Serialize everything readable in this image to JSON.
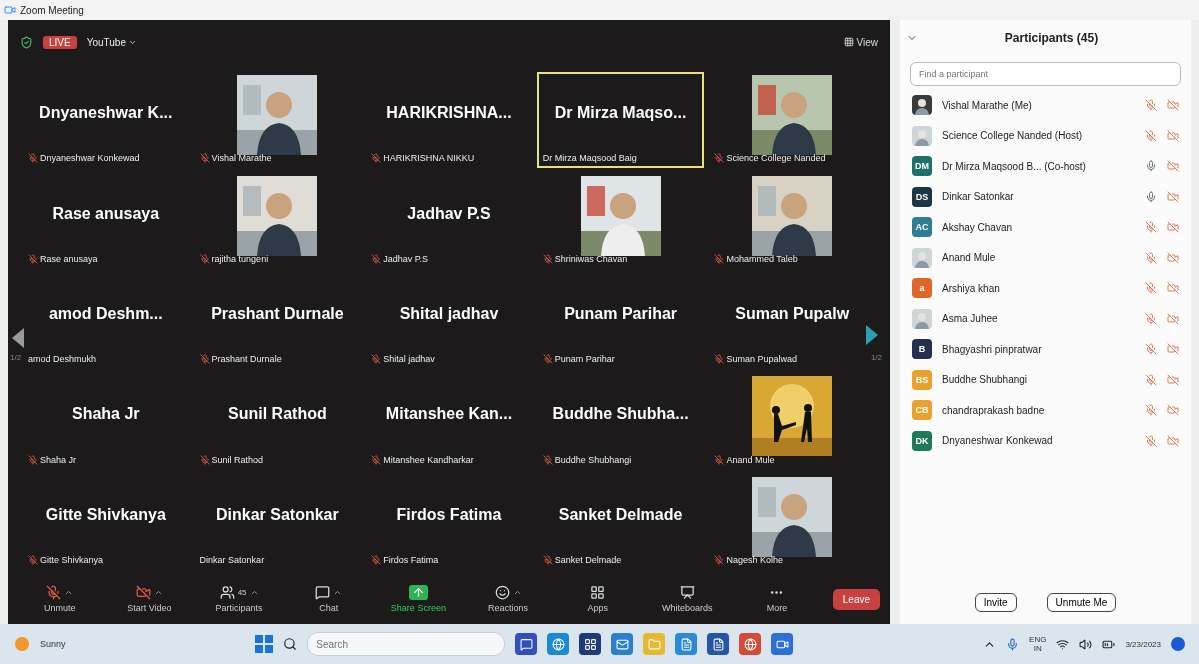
{
  "window": {
    "title": "Zoom Meeting"
  },
  "meeting_top": {
    "live": "LIVE",
    "stream": "YouTube",
    "view": "View"
  },
  "pager": {
    "left": "1/2",
    "right": "1/2"
  },
  "tiles": [
    {
      "kind": "name",
      "name": "Dnyaneshwar K...",
      "label": "Dnyaneshwar Konkewad",
      "muted": true,
      "highlighted": false
    },
    {
      "kind": "video",
      "label": "Vishal Marathe",
      "muted": true,
      "highlighted": false
    },
    {
      "kind": "name",
      "name": "HARIKRISHNA...",
      "label": "HARIKRISHNA NIKKU",
      "muted": true,
      "highlighted": false
    },
    {
      "kind": "name",
      "name": "Dr Mirza Maqso...",
      "label": "Dr Mirza Maqsood Baig",
      "muted": false,
      "highlighted": true
    },
    {
      "kind": "video",
      "label": "Science College Nanded",
      "muted": true,
      "highlighted": false
    },
    {
      "kind": "name",
      "name": "Rase anusaya",
      "label": "Rase anusaya",
      "muted": true,
      "highlighted": false
    },
    {
      "kind": "video",
      "label": "rajitha tungeni",
      "muted": true,
      "highlighted": false
    },
    {
      "kind": "name",
      "name": "Jadhav P.S",
      "label": "Jadhav P.S",
      "muted": true,
      "highlighted": false
    },
    {
      "kind": "video",
      "label": "Shriniwas Chavan",
      "muted": true,
      "highlighted": false
    },
    {
      "kind": "video",
      "label": "Mohammed Taleb",
      "muted": true,
      "highlighted": false
    },
    {
      "kind": "name",
      "name": "amod Deshm...",
      "label": "amod Deshmukh",
      "muted": false,
      "highlighted": false
    },
    {
      "kind": "name",
      "name": "Prashant Durnale",
      "label": "Prashant Durnale",
      "muted": true,
      "highlighted": false
    },
    {
      "kind": "name",
      "name": "Shital jadhav",
      "label": "Shital jadhav",
      "muted": true,
      "highlighted": false
    },
    {
      "kind": "name",
      "name": "Punam Parihar",
      "label": "Punam Parihar",
      "muted": true,
      "highlighted": false
    },
    {
      "kind": "name",
      "name": "Suman Pupalw",
      "label": "Suman Pupalwad",
      "muted": true,
      "highlighted": false
    },
    {
      "kind": "name",
      "name": "Shaha Jr",
      "label": "Shaha Jr",
      "muted": true,
      "highlighted": false
    },
    {
      "kind": "name",
      "name": "Sunil Rathod",
      "label": "Sunil Rathod",
      "muted": true,
      "highlighted": false
    },
    {
      "kind": "name",
      "name": "Mitanshee Kan...",
      "label": "Mitanshee Kandharkar",
      "muted": true,
      "highlighted": false
    },
    {
      "kind": "name",
      "name": "Buddhe Shubha...",
      "label": "Buddhe Shubhangi",
      "muted": true,
      "highlighted": false
    },
    {
      "kind": "video",
      "label": "Anand Mule",
      "muted": true,
      "highlighted": false
    },
    {
      "kind": "name",
      "name": "Gitte Shivkanya",
      "label": "Gitte Shivkanya",
      "muted": true,
      "highlighted": false
    },
    {
      "kind": "name",
      "name": "Dinkar Satonkar",
      "label": "Dinkar Satonkar",
      "muted": false,
      "highlighted": false
    },
    {
      "kind": "name",
      "name": "Firdos Fatima",
      "label": "Firdos Fatima",
      "muted": true,
      "highlighted": false
    },
    {
      "kind": "name",
      "name": "Sanket Delmade",
      "label": "Sanket Delmade",
      "muted": true,
      "highlighted": false
    },
    {
      "kind": "video",
      "label": "Nagesh Kolhe",
      "muted": true,
      "highlighted": false
    }
  ],
  "toolbar": [
    {
      "kind": "unmute",
      "label": "Unmute",
      "menu": true
    },
    {
      "kind": "video",
      "label": "Start Video",
      "menu": true
    },
    {
      "kind": "participants",
      "label": "Participants",
      "count": "45",
      "menu": true
    },
    {
      "kind": "chat",
      "label": "Chat",
      "menu": true
    },
    {
      "kind": "share",
      "label": "Share Screen",
      "menu": false
    },
    {
      "kind": "reactions",
      "label": "Reactions",
      "menu": true
    },
    {
      "kind": "apps",
      "label": "Apps",
      "menu": false
    },
    {
      "kind": "whiteboards",
      "label": "Whiteboards",
      "menu": false
    },
    {
      "kind": "more",
      "label": "More",
      "menu": false
    }
  ],
  "leave": "Leave",
  "panel": {
    "title": "Participants (45)",
    "search": {
      "placeholder": "Find a participant"
    },
    "participants": [
      {
        "name": "Vishal Marathe (Me)",
        "muted": true
      },
      {
        "name": "Science College Nanded (Host)",
        "muted": true
      },
      {
        "kind": "initials",
        "initials": "DM",
        "color": "#1f6f6a",
        "name": "Dr Mirza Maqsood B... (Co-host)",
        "muted": false
      },
      {
        "kind": "initials",
        "initials": "DS",
        "color": "#1d3646",
        "name": "Dinkar Satonkar",
        "muted": false
      },
      {
        "kind": "initials",
        "initials": "AC",
        "color": "#2f7d93",
        "name": "Akshay Chavan",
        "muted": true
      },
      {
        "name": "Anand Mule",
        "muted": true
      },
      {
        "kind": "initials",
        "initials": "a",
        "color": "#e0662a",
        "name": "Arshiya khan",
        "muted": true
      },
      {
        "name": "Asma Juhee",
        "muted": true
      },
      {
        "kind": "initials",
        "initials": "B",
        "color": "#24304e",
        "name": "Bhagyashri pinpratwar",
        "muted": true
      },
      {
        "kind": "initials",
        "initials": "BS",
        "color": "#eaa22c",
        "name": "Buddhe Shubhangi",
        "muted": true
      },
      {
        "kind": "initials",
        "initials": "CB",
        "color": "#eaa22c",
        "name": "chandraprakash badne",
        "muted": true
      },
      {
        "kind": "initials",
        "initials": "DK",
        "color": "#1f7a5a",
        "name": "Dnyaneshwar Konkewad",
        "muted": true
      }
    ],
    "buttons": [
      "Invite",
      "Unmute Me"
    ]
  },
  "taskbar": {
    "weather": "Sunny",
    "search": {
      "placeholder": "Search"
    },
    "lang": "ENG",
    "region": "IN",
    "date": "3/23/2023"
  }
}
